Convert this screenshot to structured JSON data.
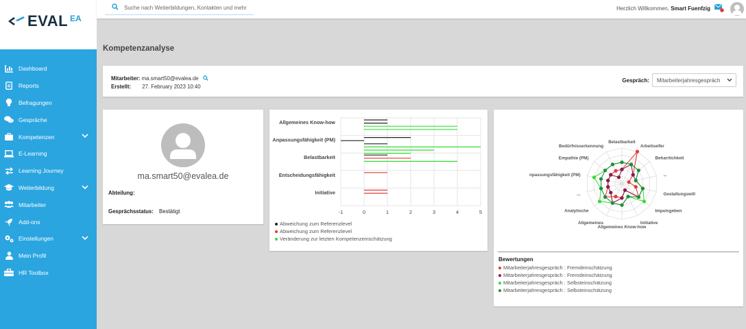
{
  "logo": {
    "text": "EVAL",
    "sup": "EA"
  },
  "search": {
    "placeholder": "Suche nach Weiterbildungen, Kontakten und mehr"
  },
  "header": {
    "welcome_prefix": "Herzlich Willkommen,",
    "user_name": "Smart Fuenfzig"
  },
  "sidebar": {
    "items": [
      {
        "label": "Dashboard",
        "icon": "dashboard-icon"
      },
      {
        "label": "Reports",
        "icon": "reports-icon"
      },
      {
        "label": "Befragungen",
        "icon": "bulb-icon"
      },
      {
        "label": "Gespräche",
        "icon": "chat-icon"
      },
      {
        "label": "Kompetenzen",
        "icon": "briefcase-icon"
      },
      {
        "label": "E-Learning",
        "icon": "laptop-icon"
      },
      {
        "label": "Learning Journey",
        "icon": "arrows-icon"
      },
      {
        "label": "Weiterbildung",
        "icon": "graduation-icon"
      },
      {
        "label": "Mitarbeiter",
        "icon": "users-icon"
      },
      {
        "label": "Add-ons",
        "icon": "rocket-icon"
      },
      {
        "label": "Einstellungen",
        "icon": "gears-icon"
      },
      {
        "label": "Mein Profil",
        "icon": "user-icon"
      },
      {
        "label": "HR Toolbox",
        "icon": "toolbox-icon"
      }
    ]
  },
  "page": {
    "title": "Kompetenzanalyse"
  },
  "info": {
    "mitarbeiter_label": "Mitarbeiter:",
    "mitarbeiter_value": "ma.smart50@evalea.de",
    "erstellt_label": "Erstellt:",
    "erstellt_value": "27. February 2023 10:40",
    "gespraech_label": "Gespräch:",
    "gespraech_value": "Mitarbeiterjahresgespräch"
  },
  "profile": {
    "email": "ma.smart50@evalea.de",
    "abteilung_label": "Abteilung:",
    "status_label": "Gesprächsstatus:",
    "status_value": "Bestätigt"
  },
  "colors": {
    "sidebar": "#2aa5e0",
    "black": "#222222",
    "red": "#e53935",
    "green": "#33dd33",
    "darkred": "#8b1a4a",
    "darkgreen": "#1e8e3e"
  },
  "chart_data": [
    {
      "type": "bar",
      "orientation": "horizontal",
      "categories": [
        "Allgemeines Know-how",
        "Anpassungsfähigkeit (PM)",
        "Belastbarkeit",
        "Entscheidungsfähigkeit",
        "Initiative"
      ],
      "xlim": [
        -1,
        5
      ],
      "xticks": [
        "-1",
        "0",
        "1",
        "2",
        "3",
        "4",
        "5"
      ],
      "series": [
        {
          "name": "Abweichung zum Referenzlevel",
          "color": "#222222",
          "values": [
            [
              1,
              1
            ],
            [
              2,
              -1,
              1
            ],
            [
              1
            ],
            [],
            []
          ]
        },
        {
          "name": "Abweichung zum Referenzlevel",
          "color": "#e53935",
          "values": [
            [],
            [],
            [
              2
            ],
            [
              1
            ],
            [
              1,
              1
            ]
          ]
        },
        {
          "name": "Veränderung zur letzten Kompetenzeinschätzung",
          "color": "#33dd33",
          "values": [
            [
              4,
              4
            ],
            [
              5,
              3,
              2
            ],
            [
              4
            ],
            [],
            []
          ]
        }
      ]
    },
    {
      "type": "radar",
      "axes": [
        "Belastbarkeit",
        "Arbeitseifer",
        "Beharrlichkeit",
        "...",
        "Gestaltungswill",
        "Impulsgeben",
        "Initiative",
        "Allgemeines Know-how",
        "Allgemeines",
        "Analytische",
        "...",
        "npassungsfähigkeit (PM)",
        "Empathie (PM)",
        "Bedürfnisserkennung"
      ],
      "title": "Bewertungen",
      "series": [
        {
          "name": "Mitarbeiterjahresgespräch : Fremdeinschätzung",
          "color": "#e53935",
          "values": [
            2,
            5,
            2,
            1,
            2,
            3,
            1,
            2,
            2,
            3,
            2,
            2,
            2,
            2
          ]
        },
        {
          "name": "Mitarbeiterjahresgespräch : Fremdeinschätzung",
          "color": "#8b1a4a",
          "values": [
            2,
            3,
            2,
            2,
            3,
            3,
            1,
            2,
            3,
            2,
            2,
            2,
            2,
            1
          ]
        },
        {
          "name": "Mitarbeiterjahresgespräch : Selbsteinschätzung",
          "color": "#33dd33",
          "values": [
            3,
            3,
            3,
            2,
            3,
            4,
            2,
            3,
            3,
            4,
            3,
            4,
            3,
            3
          ]
        },
        {
          "name": "Mitarbeiterjahresgespräch : Selbsteinschätzung",
          "color": "#1e8e3e",
          "values": [
            3,
            3,
            3,
            2,
            3,
            3,
            2,
            3,
            3,
            3,
            3,
            3,
            3,
            3
          ]
        }
      ]
    }
  ]
}
